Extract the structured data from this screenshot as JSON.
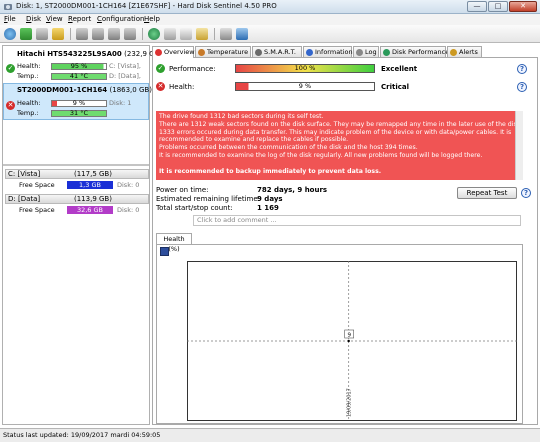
{
  "window": {
    "title": "Disk: 1, ST2000DM001-1CH164 [Z1E67SHF]  -  Hard Disk Sentinel 4.50 PRO",
    "minimize": "—",
    "maximize": "□",
    "close": "✕"
  },
  "menu": [
    {
      "u": "F",
      "rest": "ile"
    },
    {
      "u": "D",
      "rest": "isk"
    },
    {
      "u": "V",
      "rest": "iew"
    },
    {
      "u": "R",
      "rest": "eport"
    },
    {
      "u": "C",
      "rest": "onfiguration"
    },
    {
      "u": "H",
      "rest": "elp"
    }
  ],
  "disks": [
    {
      "name": "Hitachi HTS543225L9SA00",
      "size": "(232,9 GB)",
      "health_label": "Health:",
      "health_value": "95 %",
      "health_pct": 95,
      "health_side": "C: [Vista],",
      "temp_label": "Temp.:",
      "temp_value": "41 °C",
      "temp_side": "D: [Data],",
      "bar_color": "#5fd35f"
    },
    {
      "name": "ST2000DM001-1CH164",
      "size": "(1863,0 GB)",
      "health_label": "Health:",
      "health_value": "9 %",
      "health_pct": 9,
      "health_side": "Disk: 1",
      "temp_label": "Temp.:",
      "temp_value": "31 °C",
      "temp_side": "",
      "bar_color": "#e74545"
    }
  ],
  "volumes": [
    {
      "name": "C: [Vista]",
      "size": "(117,5 GB)",
      "free_label": "Free Space",
      "free_value": "1,3 GB",
      "disk": "Disk: 0",
      "color": "#1a2fd6"
    },
    {
      "name": "D: [Data]",
      "size": "(113,9 GB)",
      "free_label": "Free Space",
      "free_value": "32,6 GB",
      "disk": "Disk: 0",
      "color": "#b23cc8"
    }
  ],
  "tabs": [
    {
      "label": "Overview",
      "color": "#d33"
    },
    {
      "label": "Temperature",
      "color": "#c87a2a"
    },
    {
      "label": "S.M.A.R.T.",
      "color": "#6a6a6a"
    },
    {
      "label": "Information",
      "color": "#3366cc"
    },
    {
      "label": "Log",
      "color": "#888888"
    },
    {
      "label": "Disk Performance",
      "color": "#2a9a5a"
    },
    {
      "label": "Alerts",
      "color": "#cc9922"
    }
  ],
  "overview": {
    "performance_label": "Performance:",
    "performance_value": "100 %",
    "performance_pct": 100,
    "performance_status": "Excellent",
    "health_label": "Health:",
    "health_value": "9 %",
    "health_pct": 9,
    "health_status": "Critical",
    "alert_lines": [
      "The drive found 1312 bad sectors during its self test.",
      "There are 1312 weak sectors found on the disk surface. They may be remapped any time in the later use of the disk.",
      "1333 errors occured during data transfer. This may indicate problem of the device or with data/power cables. It is",
      "recommended to examine and replace the cables if possible.",
      "Problems occurred between the communication of the disk and the host 394 times.",
      "It is recommended to examine the log of the disk regularly. All new problems found will be logged there.",
      "",
      "It is recommended to backup immediately to prevent data loss."
    ],
    "power_on_label": "Power on time:",
    "power_on_value": "782 days, 9 hours",
    "lifetime_label": "Estimated remaining lifetime:",
    "lifetime_value": "9 days",
    "startstop_label": "Total start/stop count:",
    "startstop_value": "1 169",
    "repeat_button": "Repeat Test",
    "comment_placeholder": "Click to add comment ...",
    "help": "?"
  },
  "chart_panel": {
    "tab_label": "Health (%)"
  },
  "chart_data": {
    "type": "line",
    "title": "",
    "xlabel": "",
    "ylabel": "",
    "x": [
      "19/09/2017"
    ],
    "series": [
      {
        "values": [
          9
        ]
      }
    ],
    "point_labels": [
      "9"
    ],
    "y_tick_label": "0"
  },
  "statusbar": {
    "text": "Status last updated: 19/09/2017 mardi 04:59:05"
  }
}
